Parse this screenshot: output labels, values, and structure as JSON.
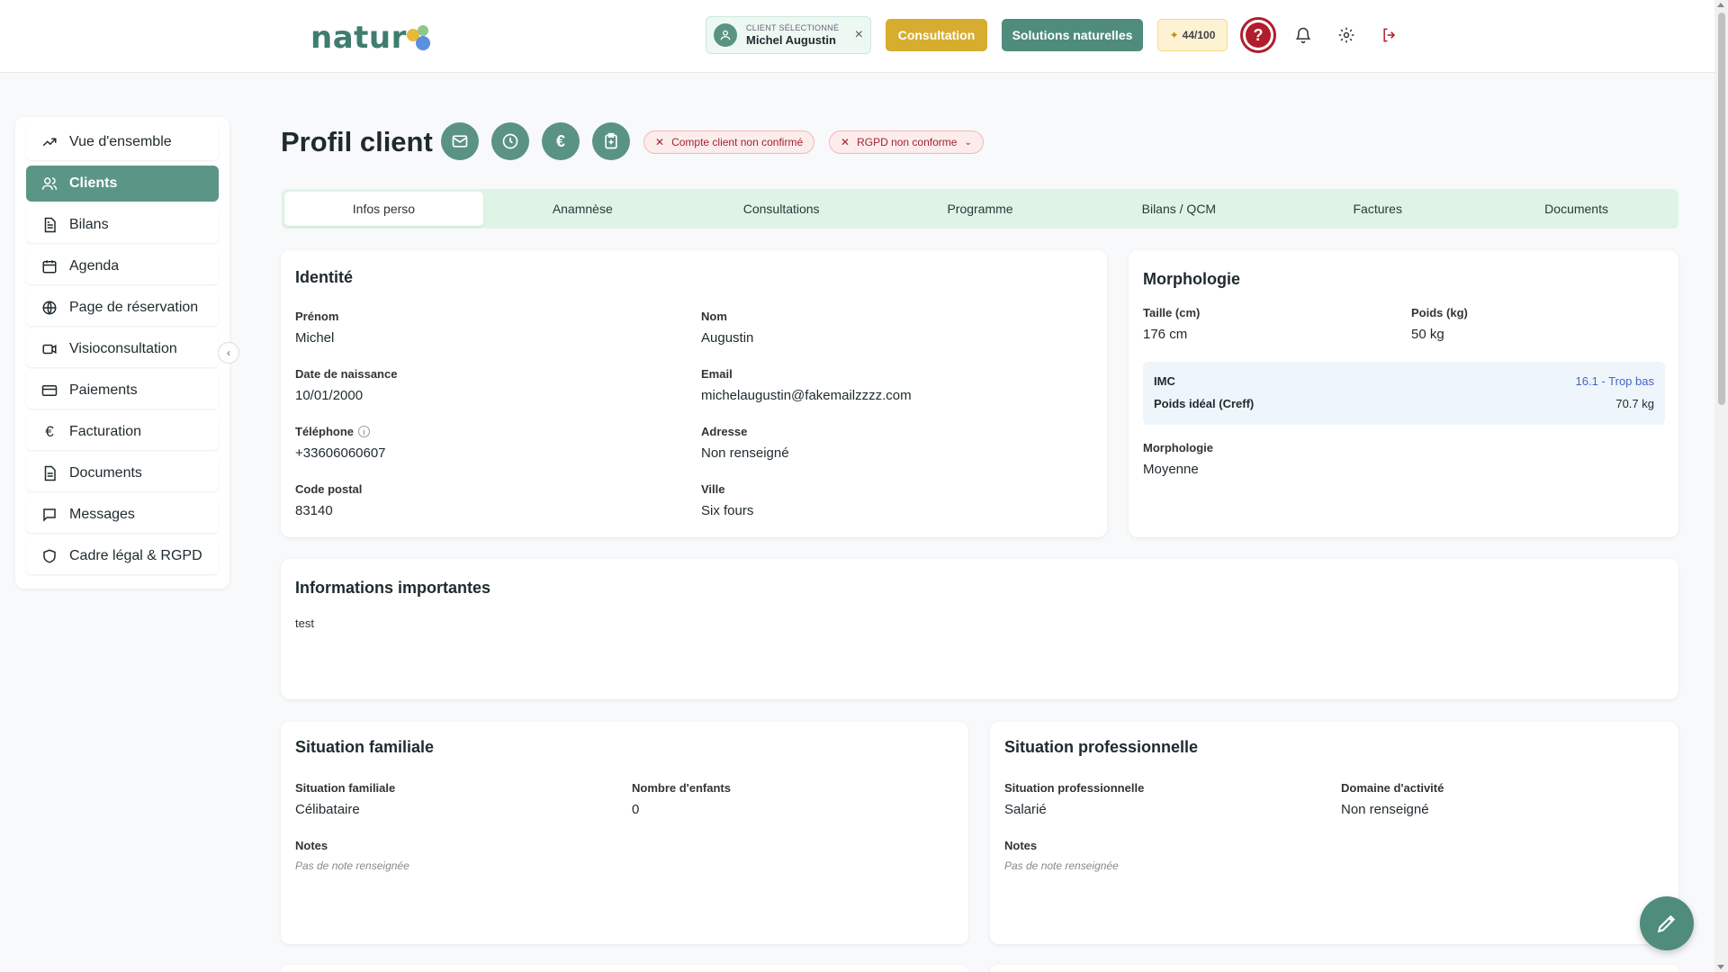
{
  "header": {
    "logo_text": "natur",
    "client_chip": {
      "label": "CLIENT SÉLECTIONNÉ",
      "name": "Michel Augustin"
    },
    "consultation_label": "Consultation",
    "solutions_label": "Solutions naturelles",
    "credits": "44/100",
    "help_symbol": "?"
  },
  "sidebar": {
    "items": [
      {
        "label": "Vue d'ensemble",
        "icon": "trending-up-icon"
      },
      {
        "label": "Clients",
        "icon": "users-icon"
      },
      {
        "label": "Bilans",
        "icon": "file-text-icon"
      },
      {
        "label": "Agenda",
        "icon": "calendar-icon"
      },
      {
        "label": "Page de réservation",
        "icon": "globe-icon"
      },
      {
        "label": "Visioconsultation",
        "icon": "video-icon"
      },
      {
        "label": "Paiements",
        "icon": "credit-card-icon"
      },
      {
        "label": "Facturation",
        "icon": "euro-icon"
      },
      {
        "label": "Documents",
        "icon": "file-icon"
      },
      {
        "label": "Messages",
        "icon": "message-icon"
      },
      {
        "label": "Cadre légal & RGPD",
        "icon": "shield-icon"
      }
    ],
    "active_index": 1,
    "collapse_symbol": "‹"
  },
  "page": {
    "title": "Profil client",
    "status": {
      "account": "Compte client non confirmé",
      "rgpd": "RGPD non conforme"
    }
  },
  "tabs": [
    "Infos perso",
    "Anamnèse",
    "Consultations",
    "Programme",
    "Bilans / QCM",
    "Factures",
    "Documents"
  ],
  "identity": {
    "title": "Identité",
    "prenom_label": "Prénom",
    "prenom": "Michel",
    "nom_label": "Nom",
    "nom": "Augustin",
    "dob_label": "Date de naissance",
    "dob": "10/01/2000",
    "email_label": "Email",
    "email": "michelaugustin@fakemailzzzz.com",
    "phone_label": "Téléphone",
    "phone": "+33606060607",
    "address_label": "Adresse",
    "address": "Non renseigné",
    "postal_label": "Code postal",
    "postal": "83140",
    "city_label": "Ville",
    "city": "Six fours"
  },
  "morphology": {
    "title": "Morphologie",
    "height_label": "Taille (cm)",
    "height": "176 cm",
    "weight_label": "Poids (kg)",
    "weight": "50 kg",
    "imc_label": "IMC",
    "imc": "16.1 - Trop bas",
    "ideal_label": "Poids idéal (Creff)",
    "ideal": "70.7 kg",
    "morpho_label": "Morphologie",
    "morpho": "Moyenne"
  },
  "important": {
    "title": "Informations importantes",
    "text": "test"
  },
  "family": {
    "title": "Situation familiale",
    "situation_label": "Situation familiale",
    "situation": "Célibataire",
    "children_label": "Nombre d'enfants",
    "children": "0",
    "notes_label": "Notes",
    "notes": "Pas de note renseignée"
  },
  "professional": {
    "title": "Situation professionnelle",
    "situation_label": "Situation professionnelle",
    "situation": "Salarié",
    "domain_label": "Domaine d'activité",
    "domain": "Non renseigné",
    "notes_label": "Notes",
    "notes": "Pas de note renseignée"
  },
  "colors": {
    "brand": "#4f8c7c",
    "accent_gold": "#d7ad2f",
    "danger": "#b11d2c",
    "tab_bg": "#dff4e6"
  }
}
